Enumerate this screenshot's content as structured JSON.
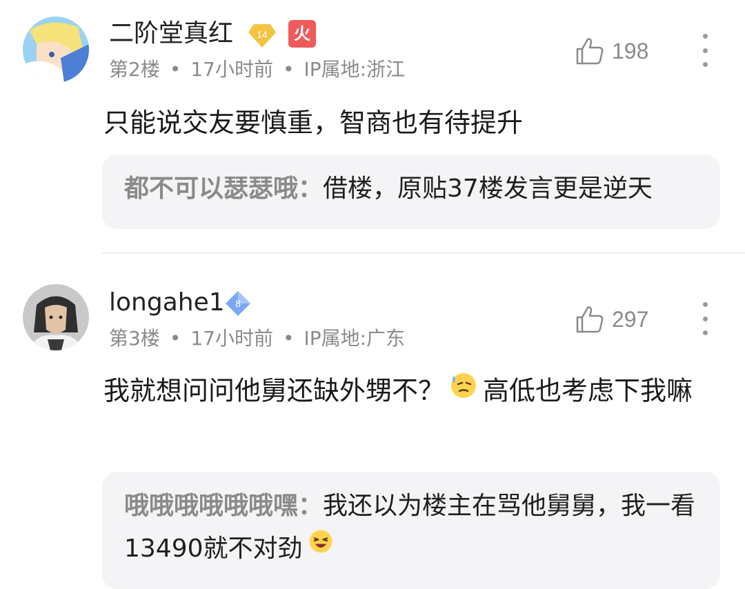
{
  "comments": [
    {
      "username": "二阶堂真红",
      "level": "14",
      "fire_badge": "火",
      "floor": "第2楼",
      "time": "17小时前",
      "ip": "IP属地:浙江",
      "likes": "198",
      "text": "只能说交友要慎重，智商也有待提升",
      "reply": {
        "name": "都不可以瑟瑟哦",
        "sep": "：",
        "text": "借楼，原贴37楼发言更是逆天"
      }
    },
    {
      "username": "longahe1",
      "level": "8",
      "floor": "第3楼",
      "time": "17小时前",
      "ip": "IP属地:广东",
      "likes": "297",
      "text_a": "我就想问问他舅还缺外甥不？",
      "text_b": "高低也考虑下我嘛",
      "reply": {
        "name": "哦哦哦哦哦哦嘿",
        "sep": "：",
        "text_a": "我还以为楼主在骂他舅舅，我一看13490就不对劲"
      }
    }
  ],
  "meta_separator": "•",
  "colors": {
    "gold_badge": "#f5c342",
    "blue_badge": "#7aa8f5",
    "fire_badge": "#f05a5a",
    "muted_text": "#8a8a8a",
    "reply_bg": "#f4f4f6"
  },
  "icons": [
    "thumbs-up-icon",
    "more-vertical-icon",
    "sweat-emoji-icon",
    "laughing-emoji-icon"
  ]
}
